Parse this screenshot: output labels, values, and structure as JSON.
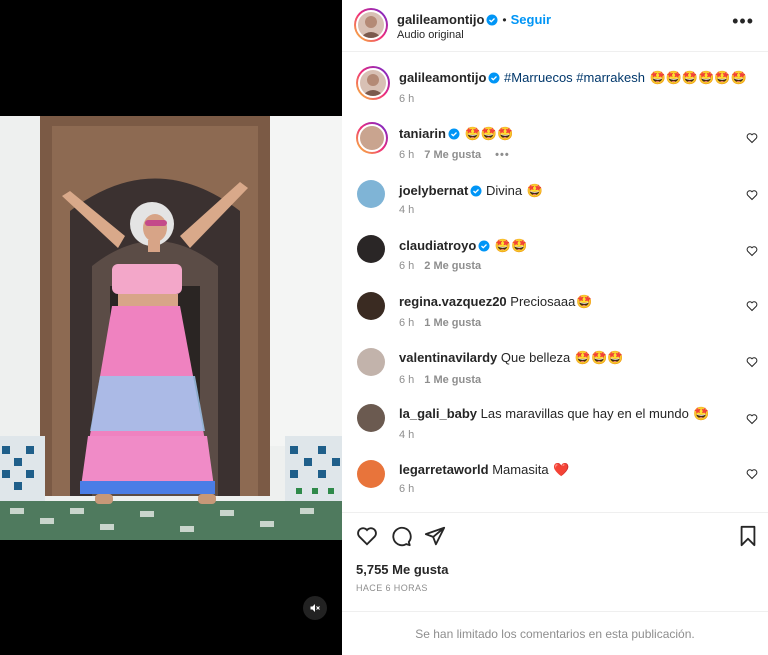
{
  "post": {
    "author": "galileamontijo",
    "follow_label": "Seguir",
    "separator": "•",
    "audio": "Audio original",
    "more_label": "•••"
  },
  "caption": {
    "user": "galileamontijo",
    "text": "#Marruecos #marrakesh",
    "emojis": "🤩🤩🤩🤩🤩🤩",
    "time": "6 h"
  },
  "comments": [
    {
      "user": "taniarin",
      "verified": true,
      "text": "",
      "emojis": "🤩🤩🤩",
      "time": "6 h",
      "likes": "7 Me gusta",
      "options": "•••"
    },
    {
      "user": "joelybernat",
      "verified": true,
      "text": "Divina",
      "emojis": "🤩",
      "time": "4 h",
      "likes": ""
    },
    {
      "user": "claudiatroyo",
      "verified": true,
      "text": "",
      "emojis": "🤩🤩",
      "time": "6 h",
      "likes": "2 Me gusta"
    },
    {
      "user": "regina.vazquez20",
      "verified": false,
      "text": "Preciosaaa",
      "emojis": "🤩",
      "time": "6 h",
      "likes": "1 Me gusta"
    },
    {
      "user": "valentinavilardy",
      "verified": false,
      "text": "Que belleza",
      "emojis": "🤩🤩🤩",
      "time": "6 h",
      "likes": "1 Me gusta"
    },
    {
      "user": "la_gali_baby",
      "verified": false,
      "text": "Las maravillas que hay en el mundo",
      "emojis": "🤩",
      "time": "4 h",
      "likes": ""
    },
    {
      "user": "legarretaworld",
      "verified": false,
      "text": "Mamasita",
      "emojis": "❤️",
      "time": "6 h",
      "likes": ""
    }
  ],
  "stats": {
    "likes": "5,755 Me gusta",
    "time": "HACE 6 HORAS"
  },
  "footer": {
    "limited": "Se han limitado los comentarios en esta publicación."
  },
  "colors": {
    "accent": "#0095f6",
    "muted": "#8e8e8e",
    "heart_emoji": "#e0245e"
  }
}
